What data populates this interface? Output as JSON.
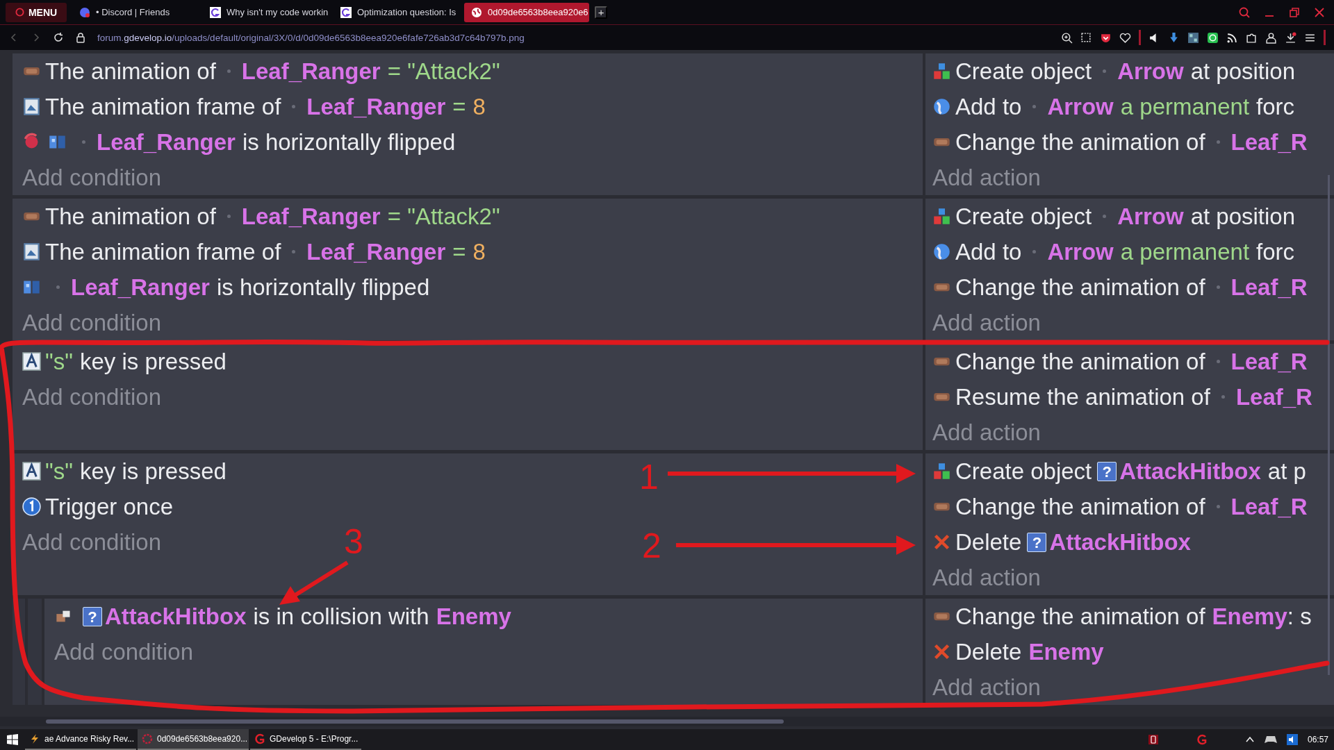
{
  "browser": {
    "menu": "MENU",
    "tabs": [
      {
        "title": "• Discord | Friends",
        "kind": "discord",
        "selected": false
      },
      {
        "title": "Why isn't my code workin",
        "kind": "gdevelop",
        "selected": false
      },
      {
        "title": "Optimization question: Is",
        "kind": "gdevelop",
        "selected": false
      },
      {
        "title": "0d09de6563b8eea920e6",
        "kind": "globe",
        "selected": true
      }
    ],
    "new_tab": "+",
    "url": {
      "subdomain": "forum.",
      "domain": "gdevelop.io",
      "path": "/uploads/default/original/3X/0/d/0d09de6563b8eea920e6fafe726ab3d7c64b797b.png"
    }
  },
  "events": [
    {
      "conditions": [
        {
          "kind": "animation",
          "inverted": false,
          "parts": [
            {
              "kind": "plain",
              "text": "The animation of"
            },
            {
              "kind": "thumb"
            },
            {
              "kind": "object",
              "text": "Leaf_Ranger"
            },
            {
              "kind": "value",
              "text": "= \"Attack2\""
            }
          ]
        },
        {
          "kind": "frame",
          "inverted": false,
          "parts": [
            {
              "kind": "plain",
              "text": "The animation frame of"
            },
            {
              "kind": "thumb"
            },
            {
              "kind": "object",
              "text": "Leaf_Ranger"
            },
            {
              "kind": "value",
              "text": "="
            },
            {
              "kind": "number",
              "text": "8"
            }
          ]
        },
        {
          "kind": "flip",
          "inverted": true,
          "parts": [
            {
              "kind": "thumb"
            },
            {
              "kind": "object",
              "text": "Leaf_Ranger"
            },
            {
              "kind": "plain",
              "text": "is horizontally flipped"
            }
          ]
        }
      ],
      "add_condition": "Add condition",
      "actions": [
        {
          "kind": "create",
          "parts": [
            {
              "kind": "plain",
              "text": "Create object"
            },
            {
              "kind": "thumb"
            },
            {
              "kind": "object",
              "text": "Arrow"
            },
            {
              "kind": "plain",
              "text": "at position"
            }
          ]
        },
        {
          "kind": "force",
          "parts": [
            {
              "kind": "plain",
              "text": "Add to"
            },
            {
              "kind": "thumb"
            },
            {
              "kind": "object",
              "text": "Arrow"
            },
            {
              "kind": "value",
              "text": "a permanent"
            },
            {
              "kind": "plain",
              "text": "forc"
            }
          ]
        },
        {
          "kind": "animation",
          "parts": [
            {
              "kind": "plain",
              "text": "Change the animation of"
            },
            {
              "kind": "thumb"
            },
            {
              "kind": "object",
              "text": "Leaf_R"
            }
          ]
        }
      ],
      "add_action": "Add action"
    },
    {
      "conditions": [
        {
          "kind": "animation",
          "inverted": false,
          "parts": [
            {
              "kind": "plain",
              "text": "The animation of"
            },
            {
              "kind": "thumb"
            },
            {
              "kind": "object",
              "text": "Leaf_Ranger"
            },
            {
              "kind": "value",
              "text": "= \"Attack2\""
            }
          ]
        },
        {
          "kind": "frame",
          "inverted": false,
          "parts": [
            {
              "kind": "plain",
              "text": "The animation frame of"
            },
            {
              "kind": "thumb"
            },
            {
              "kind": "object",
              "text": "Leaf_Ranger"
            },
            {
              "kind": "value",
              "text": "="
            },
            {
              "kind": "number",
              "text": "8"
            }
          ]
        },
        {
          "kind": "flip",
          "inverted": false,
          "parts": [
            {
              "kind": "thumb"
            },
            {
              "kind": "object",
              "text": "Leaf_Ranger"
            },
            {
              "kind": "plain",
              "text": "is horizontally flipped"
            }
          ]
        }
      ],
      "add_condition": "Add condition",
      "actions": [
        {
          "kind": "create",
          "parts": [
            {
              "kind": "plain",
              "text": "Create object"
            },
            {
              "kind": "thumb"
            },
            {
              "kind": "object",
              "text": "Arrow"
            },
            {
              "kind": "plain",
              "text": "at position"
            }
          ]
        },
        {
          "kind": "force",
          "parts": [
            {
              "kind": "plain",
              "text": "Add to"
            },
            {
              "kind": "thumb"
            },
            {
              "kind": "object",
              "text": "Arrow"
            },
            {
              "kind": "value",
              "text": "a permanent"
            },
            {
              "kind": "plain",
              "text": "forc"
            }
          ]
        },
        {
          "kind": "animation",
          "parts": [
            {
              "kind": "plain",
              "text": "Change the animation of"
            },
            {
              "kind": "thumb"
            },
            {
              "kind": "object",
              "text": "Leaf_R"
            }
          ]
        }
      ],
      "add_action": "Add action"
    },
    {
      "conditions": [
        {
          "kind": "key",
          "inverted": false,
          "parts": [
            {
              "kind": "value",
              "text": "\"s\""
            },
            {
              "kind": "plain",
              "text": "key is pressed"
            }
          ]
        }
      ],
      "add_condition": "Add condition",
      "actions": [
        {
          "kind": "animation",
          "parts": [
            {
              "kind": "plain",
              "text": "Change the animation of"
            },
            {
              "kind": "thumb"
            },
            {
              "kind": "object",
              "text": "Leaf_R"
            }
          ]
        },
        {
          "kind": "animation",
          "parts": [
            {
              "kind": "plain",
              "text": "Resume the animation of"
            },
            {
              "kind": "thumb"
            },
            {
              "kind": "object",
              "text": "Leaf_R"
            }
          ]
        }
      ],
      "add_action": "Add action"
    },
    {
      "conditions": [
        {
          "kind": "key",
          "inverted": false,
          "parts": [
            {
              "kind": "value",
              "text": "\"s\""
            },
            {
              "kind": "plain",
              "text": "key is pressed"
            }
          ]
        },
        {
          "kind": "trigger",
          "inverted": false,
          "parts": [
            {
              "kind": "plain",
              "text": "Trigger once"
            }
          ]
        }
      ],
      "add_condition": "Add condition",
      "actions": [
        {
          "kind": "create",
          "parts": [
            {
              "kind": "plain",
              "text": "Create object"
            },
            {
              "kind": "objicon",
              "text": "?"
            },
            {
              "kind": "object",
              "text": "AttackHitbox"
            },
            {
              "kind": "plain",
              "text": "at p"
            }
          ]
        },
        {
          "kind": "animation",
          "parts": [
            {
              "kind": "plain",
              "text": "Change the animation of"
            },
            {
              "kind": "thumb"
            },
            {
              "kind": "object",
              "text": "Leaf_R"
            }
          ]
        },
        {
          "kind": "delete",
          "parts": [
            {
              "kind": "plain",
              "text": "Delete"
            },
            {
              "kind": "objicon",
              "text": "?"
            },
            {
              "kind": "object",
              "text": "AttackHitbox"
            }
          ]
        }
      ],
      "add_action": "Add action",
      "children": [
        {
          "conditions": [
            {
              "kind": "collision",
              "inverted": false,
              "parts": [
                {
                  "kind": "objicon",
                  "text": "?"
                },
                {
                  "kind": "object",
                  "text": "AttackHitbox"
                },
                {
                  "kind": "plain",
                  "text": "is in collision with"
                },
                {
                  "kind": "object",
                  "text": "Enemy"
                }
              ]
            }
          ],
          "add_condition": "Add condition",
          "actions": [
            {
              "kind": "animation",
              "parts": [
                {
                  "kind": "plain",
                  "text": "Change the animation of"
                },
                {
                  "kind": "object",
                  "text": "Enemy"
                },
                {
                  "kind": "tail",
                  "text": ": s"
                }
              ]
            },
            {
              "kind": "delete",
              "parts": [
                {
                  "kind": "plain",
                  "text": "Delete"
                },
                {
                  "kind": "object",
                  "text": "Enemy"
                }
              ]
            }
          ],
          "add_action": "Add action"
        }
      ]
    }
  ],
  "annotations": {
    "numbers": [
      "1",
      "2",
      "3"
    ]
  },
  "taskbar": {
    "items": [
      {
        "title": "ae Advance Risky Rev...",
        "kind": "bolt",
        "selected": false
      },
      {
        "title": "0d09de6563b8eea920...",
        "kind": "browser",
        "selected": true
      },
      {
        "title": "GDevelop 5 - E:\\Progr...",
        "kind": "gdevelop",
        "selected": false
      }
    ],
    "time": "06:57"
  }
}
